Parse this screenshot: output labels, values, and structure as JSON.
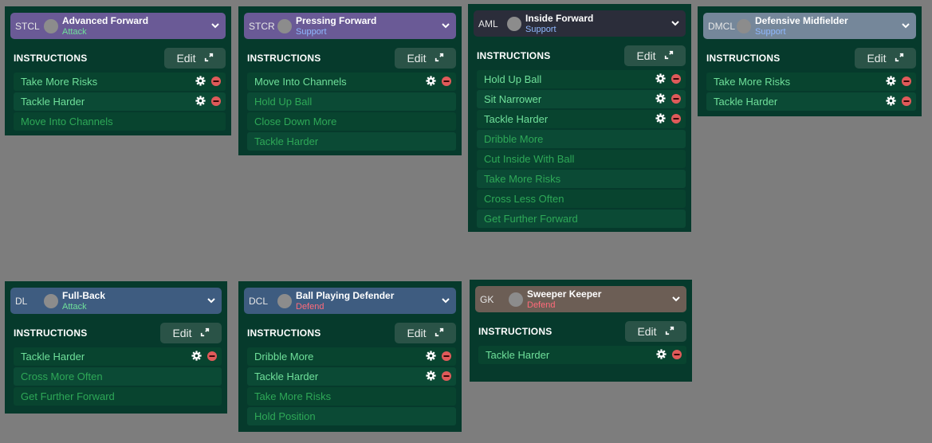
{
  "common": {
    "instructions_label": "INSTRUCTIONS",
    "edit_label": "Edit"
  },
  "panels": [
    {
      "position": "STCL",
      "role": "Advanced Forward",
      "duty": "Attack",
      "duty_color": "#6fe09a",
      "header_color": "#6a5a96",
      "items": [
        {
          "label": "Take More Risks",
          "active": true
        },
        {
          "label": "Tackle Harder",
          "active": true
        },
        {
          "label": "Move Into Channels",
          "active": false
        }
      ]
    },
    {
      "position": "STCR",
      "role": "Pressing Forward",
      "duty": "Support",
      "duty_color": "#8fb8ff",
      "header_color": "#6a5a96",
      "items": [
        {
          "label": "Move Into Channels",
          "active": true
        },
        {
          "label": "Hold Up Ball",
          "active": false
        },
        {
          "label": "Close Down More",
          "active": false
        },
        {
          "label": "Tackle Harder",
          "active": false
        }
      ]
    },
    {
      "position": "AML",
      "role": "Inside Forward",
      "duty": "Support",
      "duty_color": "#8fb8ff",
      "header_color": "#2b2d3a",
      "items": [
        {
          "label": "Hold Up Ball",
          "active": true
        },
        {
          "label": "Sit Narrower",
          "active": true
        },
        {
          "label": "Tackle Harder",
          "active": true
        },
        {
          "label": "Dribble More",
          "active": false
        },
        {
          "label": "Cut Inside With Ball",
          "active": false
        },
        {
          "label": "Take More Risks",
          "active": false
        },
        {
          "label": "Cross Less Often",
          "active": false
        },
        {
          "label": "Get Further Forward",
          "active": false
        }
      ]
    },
    {
      "position": "DMCL",
      "role": "Defensive Midfielder",
      "duty": "Support",
      "duty_color": "#8fb8ff",
      "header_color": "#75879a",
      "items": [
        {
          "label": "Take More Risks",
          "active": true
        },
        {
          "label": "Tackle Harder",
          "active": true
        }
      ]
    },
    {
      "position": "DL",
      "role": "Full-Back",
      "duty": "Attack",
      "duty_color": "#6fe09a",
      "header_color": "#3e5c80",
      "items": [
        {
          "label": "Tackle Harder",
          "active": true
        },
        {
          "label": "Cross More Often",
          "active": false
        },
        {
          "label": "Get Further Forward",
          "active": false
        }
      ]
    },
    {
      "position": "DCL",
      "role": "Ball Playing Defender",
      "duty": "Defend",
      "duty_color": "#ff6b7a",
      "header_color": "#3e5c80",
      "items": [
        {
          "label": "Dribble More",
          "active": true
        },
        {
          "label": "Tackle Harder",
          "active": true
        },
        {
          "label": "Take More Risks",
          "active": false
        },
        {
          "label": "Hold Position",
          "active": false
        }
      ]
    },
    {
      "position": "GK",
      "role": "Sweeper Keeper",
      "duty": "Defend",
      "duty_color": "#ff6b7a",
      "header_color": "#6c5e55",
      "items": [
        {
          "label": "Tackle Harder",
          "active": true
        }
      ]
    }
  ]
}
